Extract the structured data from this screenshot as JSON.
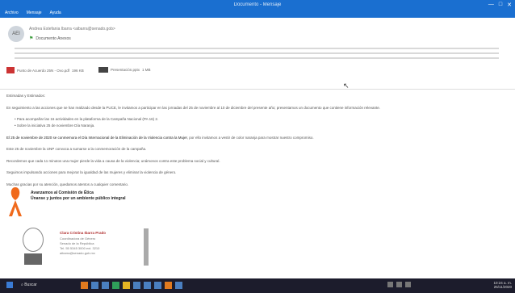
{
  "window": {
    "title": "Documento - Mensaje",
    "menus": [
      "Archivo",
      "Mensaje",
      "Ayuda"
    ],
    "controls": [
      "—",
      "□",
      "✕"
    ]
  },
  "header": {
    "avatar_initials": "AEI",
    "sender": "Andrea Estefania Ibarra <aibarra@senado.gob>",
    "subject": "Documento Anexos"
  },
  "attachments": [
    {
      "name": "Punto de Acuerdo 25N - Ovo.pdf",
      "size": "196 KB"
    },
    {
      "name": "Presentación.pptx",
      "size": "1 MB"
    }
  ],
  "body": {
    "greeting": "Estimadas y Estimados:",
    "p1": "En seguimiento a las acciones que se han realizado desde la PUCE, le invitamos a participar en las jornadas del 25 de noviembre al 10 de diciembre del presente año; presentamos un documento que contiene información relevante.",
    "bullet1": "Para acompañar las 16 actividades en la plataforma de la Campaña Nacional (PA 16) 2.",
    "bullet2": "Sobre la iniciativa 25 de noviembre Día Naranja.",
    "p2_lead": "El 25 de noviembre de 2020 se conmemora el Día Internacional de la Eliminación de la Violencia contra la Mujer",
    "p2_rest": ", por ello invitamos a vestir de color naranja para mostrar nuestro compromiso.",
    "p3": "Este 25 de noviembre la UNP convoca a sumarse a la conmemoración de la campaña.",
    "p4": "Recordemos que cada 11 minutos una mujer pierde la vida a causa de la violencia; unámonos contra este problema social y cultural.",
    "p5": "Seguimos impulsando acciones para mejorar la igualdad de las mujeres y eliminar la violencia de género.",
    "p6": "Muchas gracias por su atención, quedamos atentos a cualquier comentario."
  },
  "campaign": {
    "line1": "Avanzamos al Comisión de Ética",
    "line2": "Únanse y juntos por un ambiente público integral"
  },
  "signature": {
    "name": "Clara Cristina Ibarra Prado",
    "role": "Coordinadora de Género",
    "line1": "Senado de la República",
    "line2": "Tel. 55 5345 3000 ext. 3210",
    "line3": "aibarra@senado.gob.mx"
  },
  "taskbar": {
    "search": "Buscar",
    "time": "10:24 a. m.",
    "date": "25/11/2020"
  }
}
